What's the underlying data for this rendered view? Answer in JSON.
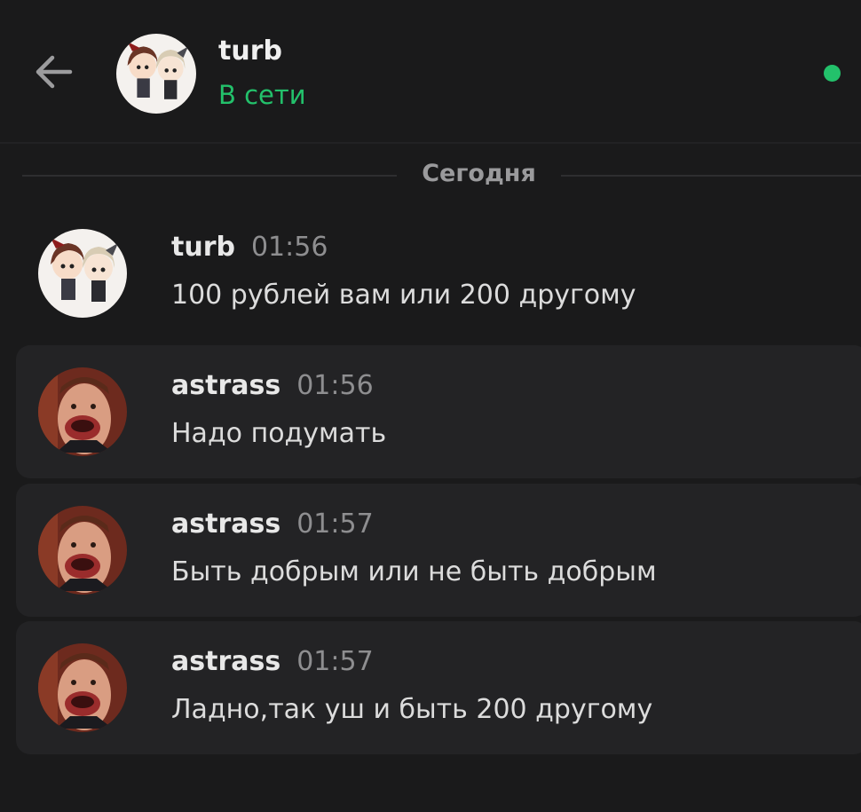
{
  "header": {
    "name": "turb",
    "status": "В сети",
    "status_color": "#23c16b"
  },
  "divider": {
    "label": "Сегодня"
  },
  "messages": [
    {
      "author": "turb",
      "time": "01:56",
      "text": "100 рублей вам или 200 другому",
      "avatar": "anime-duo-avatar"
    },
    {
      "author": "astrass",
      "time": "01:56",
      "text": "Надо подумать",
      "avatar": "face-photo-avatar"
    },
    {
      "author": "astrass",
      "time": "01:57",
      "text": "Быть добрым или не быть добрым",
      "avatar": "face-photo-avatar"
    },
    {
      "author": "astrass",
      "time": "01:57",
      "text": "Ладно,так уш и быть 200 другому",
      "avatar": "face-photo-avatar"
    }
  ]
}
